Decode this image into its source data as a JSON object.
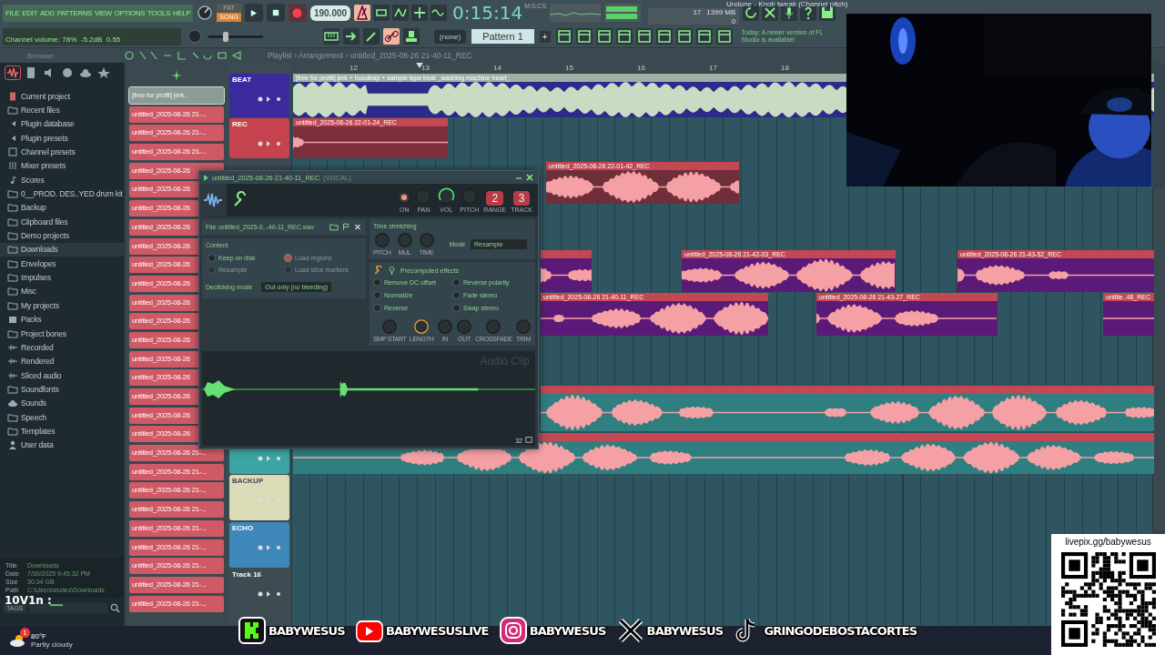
{
  "menu": [
    "FILE",
    "EDIT",
    "ADD",
    "PATTERNS",
    "VIEW",
    "OPTIONS",
    "TOOLS",
    "HELP"
  ],
  "hint": "Undone - Knob tweak (Channel pitch)",
  "modes": [
    {
      "label": "PAT",
      "selected": false
    },
    {
      "label": "SONG",
      "selected": true
    }
  ],
  "transport": {
    "recording": true,
    "tempo": "190.000",
    "time": "0:15:14",
    "time_unit": "M:S:CS",
    "cpu": "17",
    "memory": "1399 MB",
    "polyphony": "0"
  },
  "status": "Channel volume: 78%  -5.2dB  0.55",
  "pitch_slider": {
    "level": 0.3
  },
  "pattern_selector": "(none)",
  "pattern": "Pattern 1",
  "pattern_add": "+",
  "news": "Today: A newer version of FL Studio is available!",
  "browser": {
    "title": "Browser",
    "items": [
      {
        "label": "Current project",
        "kind": "project",
        "selected": false
      },
      {
        "label": "Recent files",
        "kind": "recent",
        "selected": false
      },
      {
        "label": "Plugin database",
        "kind": "plugin",
        "selected": false
      },
      {
        "label": "Plugin presets",
        "kind": "plugin",
        "selected": false
      },
      {
        "label": "Channel presets",
        "kind": "channel",
        "selected": false
      },
      {
        "label": "Mixer presets",
        "kind": "mixer",
        "selected": false
      },
      {
        "label": "Scores",
        "kind": "note",
        "selected": false
      },
      {
        "label": "0__PROD. DES..YED drum kit",
        "kind": "folder",
        "selected": false
      },
      {
        "label": "Backup",
        "kind": "folder",
        "selected": false
      },
      {
        "label": "Clipboard files",
        "kind": "folder",
        "selected": false
      },
      {
        "label": "Demo projects",
        "kind": "folder",
        "selected": false
      },
      {
        "label": "Downloads",
        "kind": "folder",
        "selected": true
      },
      {
        "label": "Envelopes",
        "kind": "folder",
        "selected": false
      },
      {
        "label": "Impulses",
        "kind": "folder",
        "selected": false
      },
      {
        "label": "Misc",
        "kind": "folder",
        "selected": false
      },
      {
        "label": "My projects",
        "kind": "folder",
        "selected": false
      },
      {
        "label": "Packs",
        "kind": "packs",
        "selected": false
      },
      {
        "label": "Project bones",
        "kind": "folder",
        "selected": false
      },
      {
        "label": "Recorded",
        "kind": "audio",
        "selected": false
      },
      {
        "label": "Rendered",
        "kind": "audio",
        "selected": false
      },
      {
        "label": "Sliced audio",
        "kind": "audio",
        "selected": false
      },
      {
        "label": "Soundfonts",
        "kind": "folder",
        "selected": false
      },
      {
        "label": "Sounds",
        "kind": "cloud",
        "selected": false
      },
      {
        "label": "Speech",
        "kind": "folder",
        "selected": false
      },
      {
        "label": "Templates",
        "kind": "folder",
        "selected": false
      },
      {
        "label": "User data",
        "kind": "user",
        "selected": false
      }
    ],
    "info": [
      {
        "label": "Title",
        "value": "Downloads"
      },
      {
        "label": "Date",
        "value": "7/30/2025 9:45:32 PM"
      },
      {
        "label": "Size",
        "value": "30.04 GB"
      },
      {
        "label": "Path",
        "value": "C:\\Users\\eudes\\Downloads"
      }
    ],
    "tags": "TAGS"
  },
  "chat": "10V1n :",
  "playlist": {
    "breadcrumb": "Playlist › Arrangement › untitled_2025-08-26 21-40-11_REC",
    "ruler": [
      "12",
      "13",
      "14",
      "15",
      "16",
      "17",
      "18"
    ],
    "channels": [
      {
        "label": "[free for profit] jerk..",
        "selected": true
      },
      {
        "label": "untitled_2025-08-26 21-...",
        "selected": false
      },
      {
        "label": "untitled_2025-08-26 21-...",
        "selected": false
      },
      {
        "label": "untitled_2025-08-26 21-...",
        "selected": false
      },
      {
        "label": "untitled_2025-08-26",
        "selected": false
      },
      {
        "label": "untitled_2025-08-26",
        "selected": false
      },
      {
        "label": "untitled_2025-08-26",
        "selected": false
      },
      {
        "label": "untitled_2025-08-26",
        "selected": false
      },
      {
        "label": "untitled_2025-08-26",
        "selected": false
      },
      {
        "label": "untitled_2025-08-26",
        "selected": false
      },
      {
        "label": "untitled_2025-08-26",
        "selected": false
      },
      {
        "label": "untitled_2025-08-26",
        "selected": false
      },
      {
        "label": "untitled_2025-08-26",
        "selected": false
      },
      {
        "label": "untitled_2025-08-26",
        "selected": false
      },
      {
        "label": "untitled_2025-08-26",
        "selected": false
      },
      {
        "label": "untitled_2025-08-26",
        "selected": false
      },
      {
        "label": "untitled_2025-08-26",
        "selected": false
      },
      {
        "label": "untitled_2025-08-26",
        "selected": false
      },
      {
        "label": "untitled_2025-08-26",
        "selected": false
      },
      {
        "label": "untitled_2025-08-26 21-...",
        "selected": false
      },
      {
        "label": "untitled_2025-08-26 21-...",
        "selected": false
      },
      {
        "label": "untitled_2025-08-26 21-...",
        "selected": false
      },
      {
        "label": "untitled_2025-08-26 21-...",
        "selected": false
      },
      {
        "label": "untitled_2025-08-26 21-...",
        "selected": false
      },
      {
        "label": "untitled_2025-08-26 21-...",
        "selected": false
      },
      {
        "label": "untitled_2025-08-26 21-...",
        "selected": false
      },
      {
        "label": "untitled_2025-08-26 21-...",
        "selected": false
      },
      {
        "label": "untitled_2025-08-26 21-...",
        "selected": false
      }
    ],
    "tracks": [
      {
        "name": "BEAT",
        "color": "#3a2a9e"
      },
      {
        "name": "REC",
        "color": "#c4434e"
      },
      {
        "color": "#3aa5a2"
      },
      {
        "name": "BACKUP",
        "color": "#dadcb8"
      },
      {
        "name": "ECHO",
        "color": "#3f88ba"
      },
      {
        "name": "Track 16",
        "color": "#3d4b53"
      }
    ],
    "clips": [
      {
        "title": "[free for profit] jerk + hoodtrap + sample type beat _washing machine heart_",
        "color": "#2c2a8a"
      },
      {
        "title": "untitled_2025-08-26 22-01-24_REC",
        "color": "#7a2f3a"
      },
      {
        "title": "untitled_2025-08-26 22-01-42_REC",
        "color": "#6e2f3a"
      },
      {
        "color": "#5c1a78"
      },
      {
        "title": "untitled_2025-08-26 21-42-03_REC",
        "color": "#5c1a78"
      },
      {
        "title": "untitled_2025-08-26 21-43-52_REC",
        "color": "#5c1a78"
      },
      {
        "title": "untitled_2025-08-26 21-40-11_REC",
        "color": "#5c1a78"
      },
      {
        "title": "untitled_2025-08-26 21-43-27_REC",
        "color": "#5c1a78"
      },
      {
        "title": "untitle..48_REC",
        "color": "#5c1a78"
      },
      {
        "color": "#2f7f80"
      },
      {
        "color": "#2f7f80"
      }
    ]
  },
  "clip_window": {
    "title": "untitled_2025-08-26 21-40-11_REC",
    "suffix": "(VOCAL)",
    "controls": [
      {
        "kind": "led",
        "label": "ON",
        "on": true
      },
      {
        "kind": "knob",
        "label": "PAN",
        "selected": false
      },
      {
        "kind": "knob",
        "label": "VOL",
        "selected": true
      },
      {
        "kind": "knob",
        "label": "PITCH",
        "selected": false
      },
      {
        "kind": "counter",
        "label": "RANGE",
        "value": "2"
      },
      {
        "kind": "counter",
        "label": "TRACK",
        "value": "3"
      }
    ],
    "file_label": "File",
    "file": "untitled_2025-0..-40-11_REC.wav",
    "content_title": "Content",
    "content_options": [
      {
        "label": "Keep on disk",
        "checked": false,
        "disabled": false
      },
      {
        "label": "Load regions",
        "checked": true,
        "disabled": true
      },
      {
        "label": "Resample",
        "checked": false,
        "disabled": true
      },
      {
        "label": "Load slice markers",
        "checked": false,
        "disabled": true
      }
    ],
    "declick_label": "Declicking mode",
    "declick": "Out only (no bleeding)",
    "stretch_title": "Time stretching",
    "stretch_knobs": [
      {
        "label": "PITCH",
        "selected": false
      },
      {
        "label": "MUL",
        "selected": false
      },
      {
        "label": "TIME",
        "selected": false
      }
    ],
    "mode_label": "Mode",
    "mode": "Resample",
    "effects_title": "Precomputed effects",
    "effects": [
      {
        "label": "Remove DC offset",
        "checked": false
      },
      {
        "label": "Reverse polarity",
        "checked": false
      },
      {
        "label": "Normalize",
        "checked": false
      },
      {
        "label": "Fade stereo",
        "checked": false
      },
      {
        "label": "Reverse",
        "checked": false
      },
      {
        "label": "Swap stereo",
        "checked": false
      }
    ],
    "knobs": [
      {
        "label": "SMP START",
        "selected": false
      },
      {
        "label": "LENGTH",
        "selected": true
      },
      {
        "label": "IN",
        "selected": false
      },
      {
        "label": "OUT",
        "selected": false
      },
      {
        "label": "CROSSFADE",
        "selected": false
      },
      {
        "label": "TRIM",
        "selected": false
      }
    ],
    "watermark": "Audio Clip",
    "zoom": "32"
  },
  "socials": [
    {
      "kind": "kick",
      "handle": "BABYWESUS"
    },
    {
      "kind": "youtube",
      "handle": "BABYWESUSLIVE"
    },
    {
      "kind": "instagram",
      "handle": "BABYWESUS"
    },
    {
      "kind": "x",
      "handle": "BABYWESUS"
    },
    {
      "kind": "tiktok",
      "handle": "GRINGODEBOSTACORTES"
    }
  ],
  "qr": {
    "url": "livepix.gg/babywesus"
  },
  "weather": {
    "badge": "1",
    "temp": "80°F",
    "text": "Partly cloudy"
  }
}
